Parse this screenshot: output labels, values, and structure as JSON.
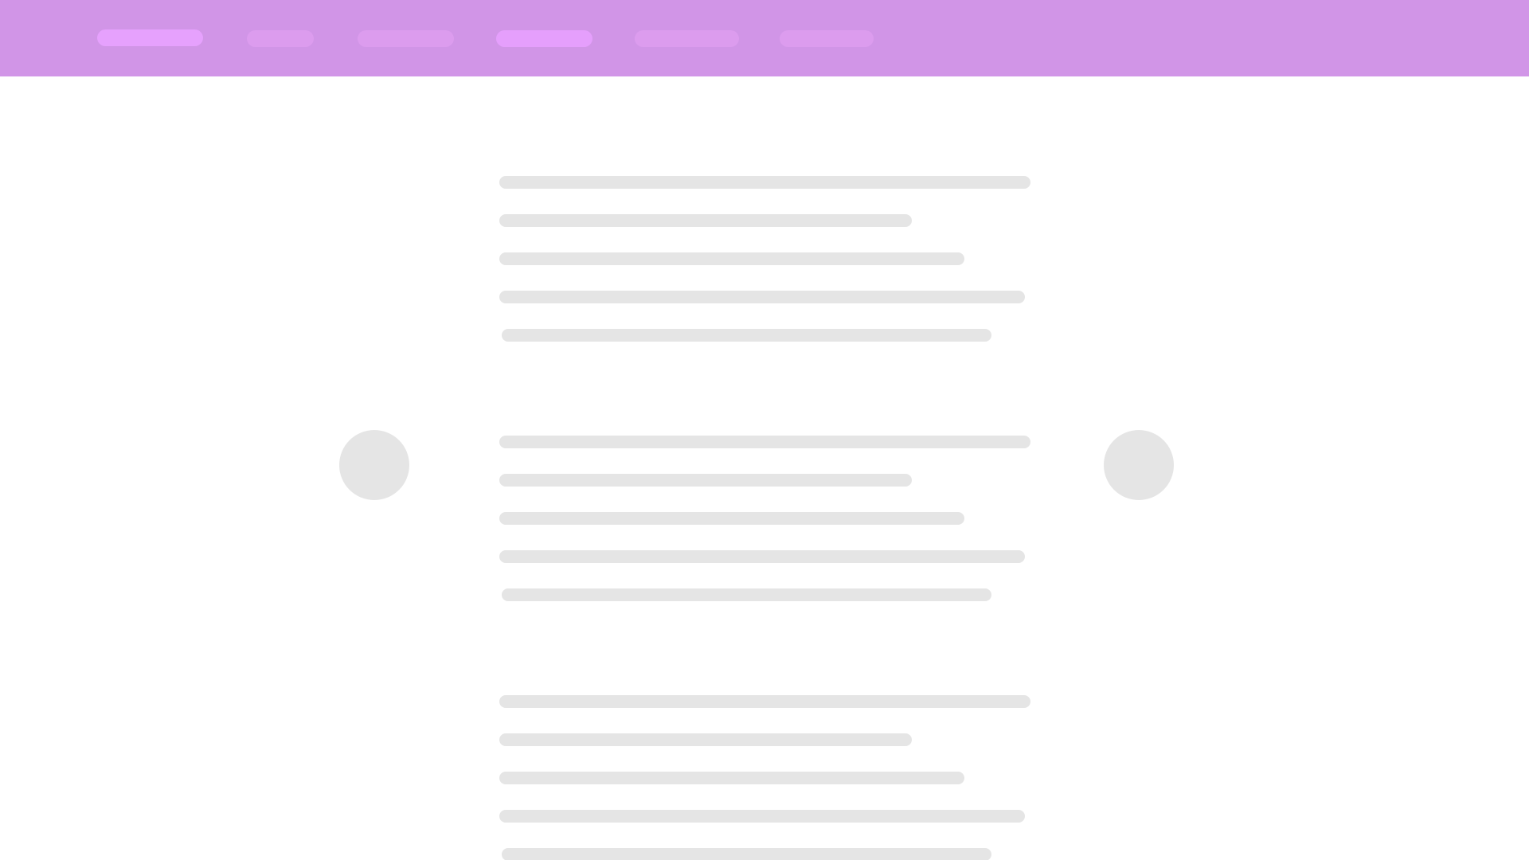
{
  "colors": {
    "navbar_bg": "#d195e7",
    "nav_pill": "#dc9cee",
    "nav_pill_active": "#e6a1fd",
    "skeleton": "#e5e5e5",
    "page_bg": "#ffffff"
  },
  "navbar": {
    "items": [
      {
        "state": "active"
      },
      {
        "state": "default"
      },
      {
        "state": "default"
      },
      {
        "state": "highlighted"
      },
      {
        "state": "default"
      },
      {
        "state": "default"
      }
    ]
  },
  "content": {
    "blocks": [
      {
        "lines": 5
      },
      {
        "lines": 5
      },
      {
        "lines": 5
      }
    ]
  },
  "carousel": {
    "previous_icon": "circle-previous-icon",
    "next_icon": "circle-next-icon"
  }
}
